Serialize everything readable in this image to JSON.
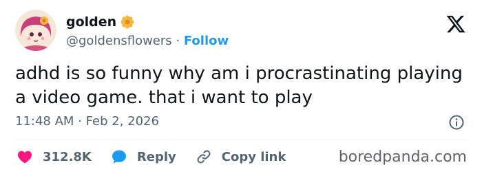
{
  "user": {
    "name": "golden",
    "handle": "@goldensflowers",
    "separator": "·",
    "follow_label": "Follow"
  },
  "tweet": {
    "text": "adhd is so funny why am i procrastinating playing a video game. that i want to play",
    "time": "11:48 AM",
    "time_sep": "·",
    "date": "Feb 2, 2026"
  },
  "actions": {
    "likes": "312.8K",
    "reply_label": "Reply",
    "copy_label": "Copy link"
  },
  "watermark": "boredpanda.com",
  "colors": {
    "accent": "#1d9bf0",
    "like": "#f91880",
    "secondary": "#536471"
  },
  "icons": [
    "verified-flower-badge-icon",
    "x-logo-icon",
    "info-icon",
    "heart-icon",
    "reply-bubble-icon",
    "link-icon"
  ]
}
